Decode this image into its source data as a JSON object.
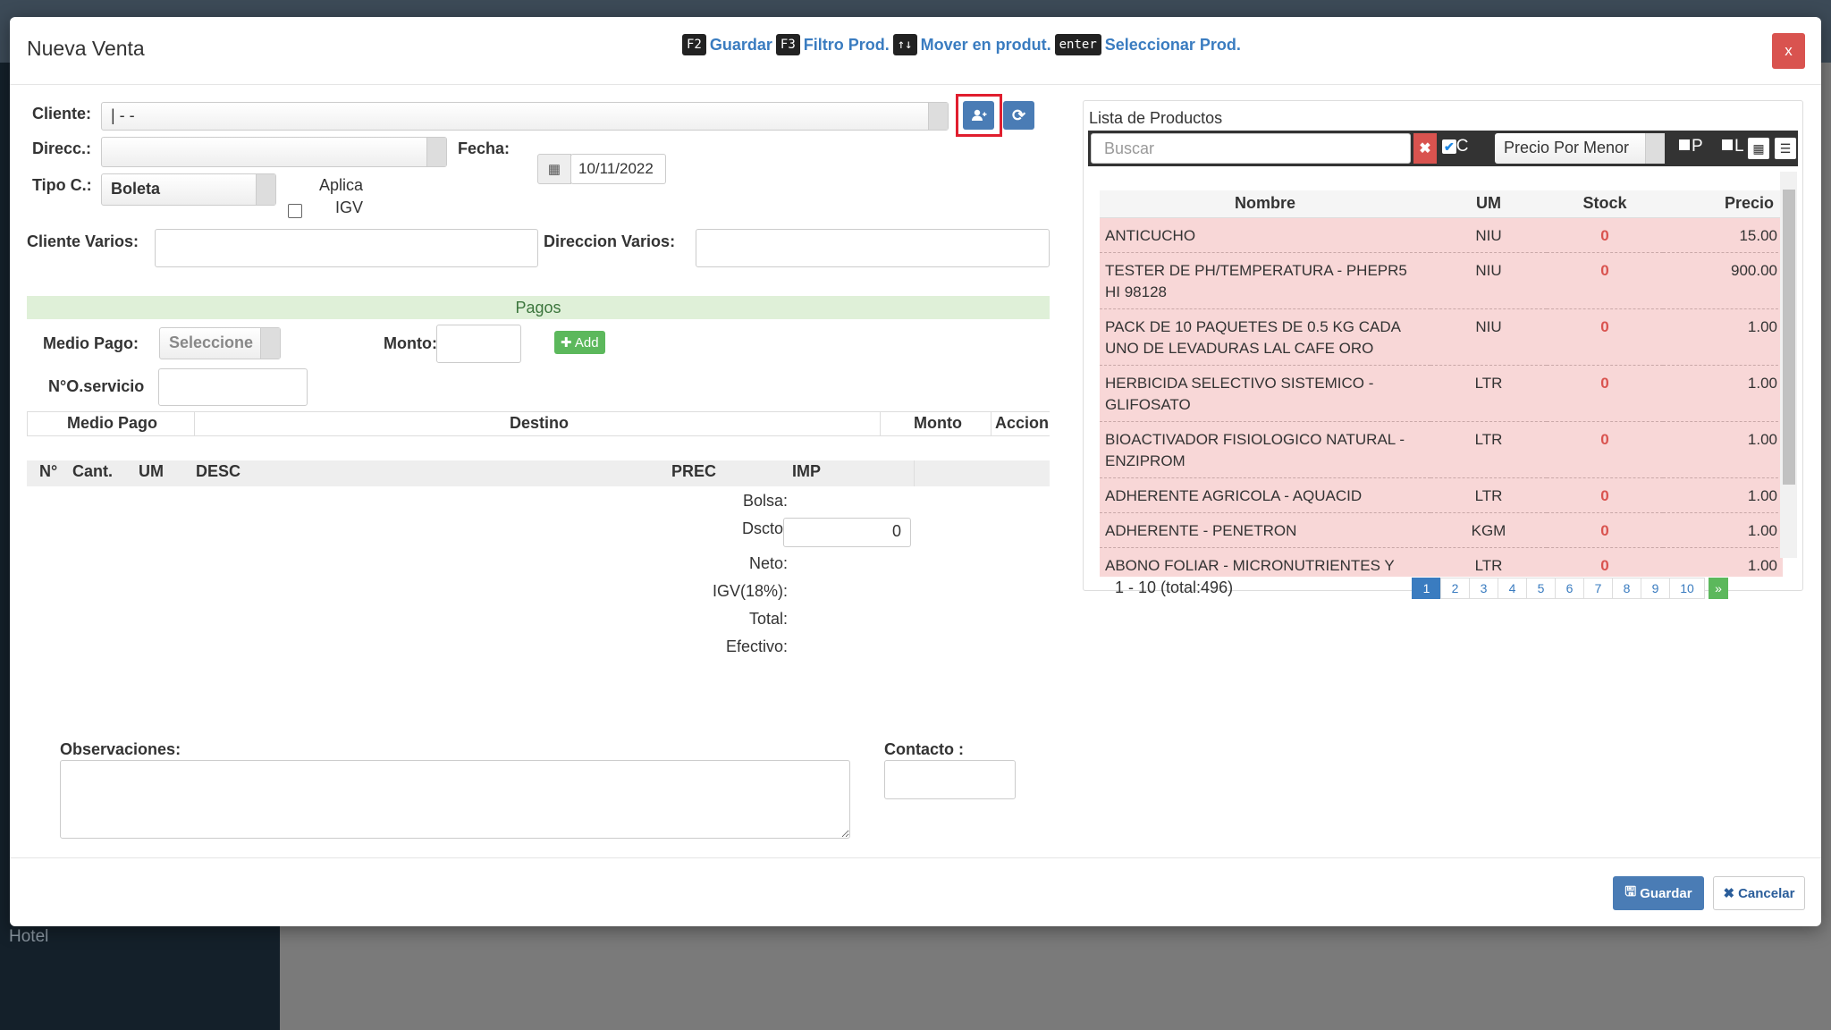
{
  "background": {
    "sidebar_item": "Hotel"
  },
  "modal": {
    "title": "Nueva Venta",
    "close_label": "x",
    "hotkeys": [
      {
        "key": "F2",
        "label": "Guardar"
      },
      {
        "key": "F3",
        "label": "Filtro Prod."
      },
      {
        "key": "↑↓",
        "label": "Mover en produt."
      },
      {
        "key": "enter",
        "label": "Seleccionar Prod."
      }
    ]
  },
  "form": {
    "cliente_label": "Cliente:",
    "cliente_value": "| - -",
    "direcc_label": "Direcc.:",
    "fecha_label": "Fecha:",
    "fecha_value": "10/11/2022",
    "tipo_label": "Tipo C.:",
    "tipo_value": "Boleta",
    "aplica_label": "Aplica",
    "igv_label": "IGV",
    "cliente_varios_label": "Cliente Varios:",
    "direccion_varios_label": "Direccion Varios:"
  },
  "pagos": {
    "header": "Pagos",
    "medio_label": "Medio Pago:",
    "medio_value": "Seleccione",
    "monto_label": "Monto:",
    "add_label": "Add",
    "oservicio_label": "N°O.servicio",
    "columns": [
      "Medio Pago",
      "Destino",
      "Monto",
      "Accion"
    ]
  },
  "items": {
    "columns": [
      "N°",
      "Cant.",
      "UM",
      "DESC",
      "PREC",
      "IMP"
    ]
  },
  "totals": {
    "bolsa": "Bolsa:",
    "dscto": "Dscto.",
    "dscto_value": "0",
    "neto": "Neto:",
    "igv": "IGV(18%):",
    "total": "Total:",
    "efectivo": "Efectivo:"
  },
  "notes": {
    "observaciones_label": "Observaciones:",
    "contacto_label": "Contacto :"
  },
  "footer": {
    "guardar": "Guardar",
    "cancelar": "Cancelar"
  },
  "productos": {
    "title": "Lista de Productos",
    "search_placeholder": "Buscar",
    "check_c": "C",
    "price_mode": "Precio Por Menor",
    "flag_p": "P",
    "flag_l": "L",
    "columns": [
      "Nombre",
      "UM",
      "Stock",
      "Precio"
    ],
    "rows": [
      {
        "nombre": "ANTICUCHO",
        "um": "NIU",
        "stock": "0",
        "precio": "15.00"
      },
      {
        "nombre": "TESTER DE PH/TEMPERATURA - PHEPR5 HI 98128",
        "um": "NIU",
        "stock": "0",
        "precio": "900.00"
      },
      {
        "nombre": "PACK DE 10 PAQUETES DE 0.5 KG CADA UNO DE LEVADURAS LAL CAFE ORO",
        "um": "NIU",
        "stock": "0",
        "precio": "1.00"
      },
      {
        "nombre": "HERBICIDA SELECTIVO SISTEMICO - GLIFOSATO",
        "um": "LTR",
        "stock": "0",
        "precio": "1.00"
      },
      {
        "nombre": "BIOACTIVADOR FISIOLOGICO NATURAL - ENZIPROM",
        "um": "LTR",
        "stock": "0",
        "precio": "1.00"
      },
      {
        "nombre": "ADHERENTE AGRICOLA - AQUACID",
        "um": "LTR",
        "stock": "0",
        "precio": "1.00"
      },
      {
        "nombre": "ADHERENTE - PENETRON",
        "um": "KGM",
        "stock": "0",
        "precio": "1.00"
      },
      {
        "nombre": "ABONO FOLIAR - MICRONUTRIENTES Y BORO",
        "um": "LTR",
        "stock": "0",
        "precio": "1.00"
      }
    ],
    "pager_info": "1 - 10 (total:496)",
    "pages": [
      "1",
      "2",
      "3",
      "4",
      "5",
      "6",
      "7",
      "8",
      "9",
      "10"
    ],
    "next": "»"
  }
}
